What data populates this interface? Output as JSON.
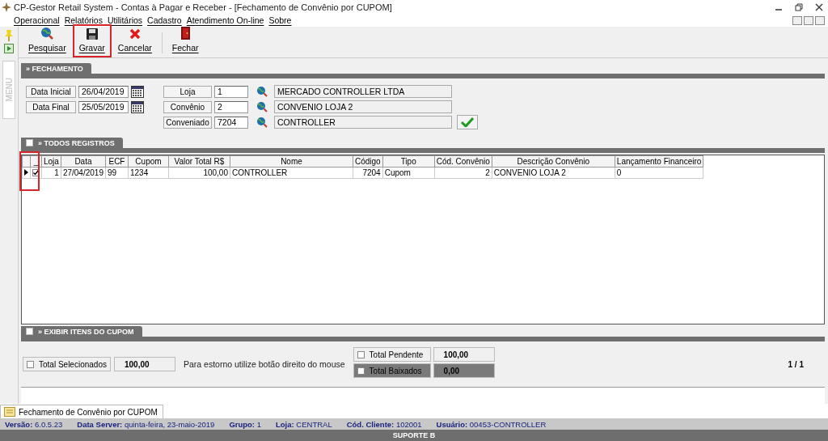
{
  "window": {
    "title": "CP-Gestor Retail System - Contas à Pagar e Receber - [Fechamento de Convênio por CUPOM]"
  },
  "menu": [
    "Operacional",
    "Relatórios",
    "Utilitários",
    "Cadastro",
    "Atendimento On-line",
    "Sobre"
  ],
  "side_tab": "MENU",
  "toolbar": [
    {
      "kind": "search",
      "label": "Pesquisar",
      "highlighted": false
    },
    {
      "kind": "save",
      "label": "Gravar",
      "highlighted": true
    },
    {
      "kind": "cancel",
      "label": "Cancelar",
      "highlighted": false
    },
    {
      "kind": "exit",
      "label": "Fechar",
      "highlighted": false
    }
  ],
  "fechamento": {
    "title": "» FECHAMENTO",
    "dates": [
      {
        "label": "Data Inicial",
        "value": "26/04/2019"
      },
      {
        "label": "Data Final",
        "value": "25/05/2019"
      }
    ],
    "lookups": [
      {
        "label": "Loja",
        "code": "1",
        "description": "MERCADO CONTROLLER LTDA"
      },
      {
        "label": "Convênio",
        "code": "2",
        "description": "CONVENIO LOJA 2"
      },
      {
        "label": "Conveniado",
        "code": "7204",
        "description": "CONTROLLER"
      }
    ]
  },
  "registros": {
    "title": "» TODOS REGISTROS",
    "checked": false,
    "select_column_highlighted": true,
    "select_header": "_",
    "columns": [
      "Loja",
      "Data",
      "ECF",
      "Cupom",
      "Valor Total R$",
      "Nome",
      "Código",
      "Tipo",
      "Cód. Convênio",
      "Descrição Convênio",
      "Lançamento Financeiro"
    ],
    "rows": [
      {
        "current": true,
        "checked": true,
        "cells": [
          "1",
          "27/04/2019",
          "99",
          "1234",
          "100,00",
          "CONTROLLER",
          "7204",
          "Cupom",
          "2",
          "CONVENIO LOJA 2",
          "0"
        ]
      }
    ]
  },
  "itens": {
    "title": "» EXIBIR ITENS DO CUPOM",
    "checked": false
  },
  "totals": {
    "selecionados": {
      "label": "Total Selecionados",
      "checked": false,
      "value": "100,00"
    },
    "hint": "Para estorno utilize botão direito do mouse",
    "pendente": {
      "label": "Total Pendente",
      "checked": false,
      "value": "100,00"
    },
    "baixados": {
      "label": "Total Baixados",
      "checked": false,
      "value": "0,00"
    },
    "page": "1 / 1"
  },
  "document_tab": "Fechamento de Convênio por CUPOM",
  "status_bar": [
    {
      "label": "Versão:",
      "value": "6.0.5.23"
    },
    {
      "label": "Data Server:",
      "value": "quinta-feira, 23-maio-2019"
    },
    {
      "label": "Grupo:",
      "value": "1"
    },
    {
      "label": "Loja:",
      "value": "CENTRAL"
    },
    {
      "label": "Cód. Cliente:",
      "value": "102001"
    },
    {
      "label": "Usuário:",
      "value": "00453-CONTROLLER"
    }
  ],
  "footer": "SUPORTE B"
}
